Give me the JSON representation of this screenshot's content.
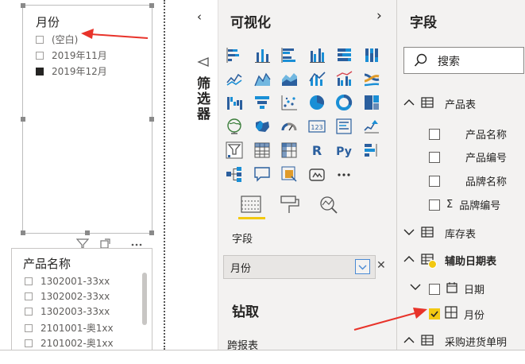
{
  "slicer_month": {
    "title": "月份",
    "items": [
      {
        "label": "(空白)",
        "checked": false
      },
      {
        "label": "2019年11月",
        "checked": false
      },
      {
        "label": "2019年12月",
        "checked": true
      }
    ]
  },
  "slicer_product": {
    "title": "产品名称",
    "items": [
      "1302001-33xx",
      "1302002-33xx",
      "1302003-33xx",
      "2101001-奥1xx",
      "2101002-奥1xx"
    ]
  },
  "filters_label": "筛选器",
  "visualizations": {
    "title": "可视化",
    "icons": [
      "stacked-bar-icon",
      "stacked-column-icon",
      "clustered-bar-icon",
      "clustered-column-icon",
      "100-stacked-bar-icon",
      "100-stacked-column-icon",
      "line-chart-icon",
      "area-chart-icon",
      "stacked-area-icon",
      "line-column-icon",
      "line-clustered-column-icon",
      "ribbon-chart-icon",
      "waterfall-icon",
      "funnel-icon",
      "scatter-icon",
      "pie-chart-icon",
      "donut-chart-icon",
      "treemap-icon",
      "map-icon",
      "filled-map-icon",
      "gauge-icon",
      "card-icon",
      "multirow-card-icon",
      "kpi-icon",
      "slicer-icon",
      "table-icon",
      "matrix-icon",
      "r-visual-icon",
      "python-visual-icon",
      "key-influencers-icon",
      "decomposition-tree-icon",
      "qa-icon",
      "smart-narrative-icon",
      "paginated-report-icon",
      "more-icon"
    ],
    "r_label": "R",
    "py_label": "Py",
    "card_label": "123",
    "more_label": "···",
    "field_section": "字段",
    "field_value": "月份",
    "drill_title": "钻取",
    "cross_report": "跨报表"
  },
  "fields": {
    "title": "字段",
    "search_placeholder": "搜索",
    "tables": [
      {
        "name": "产品表",
        "expanded": true,
        "fields": [
          {
            "name": "产品名称",
            "checked": false,
            "sigma": false
          },
          {
            "name": "产品编号",
            "checked": false,
            "sigma": false
          },
          {
            "name": "品牌名称",
            "checked": false,
            "sigma": false
          },
          {
            "name": "品牌编号",
            "checked": false,
            "sigma": true
          }
        ]
      },
      {
        "name": "库存表",
        "expanded": false,
        "fields": []
      },
      {
        "name": "辅助日期表",
        "expanded": true,
        "bold": true,
        "fields": [
          {
            "name": "日期",
            "checked": false,
            "type": "calendar"
          },
          {
            "name": "月份",
            "checked": true,
            "type": "hierarchy"
          }
        ]
      },
      {
        "name": "采购进货单明",
        "expanded": true,
        "fields": []
      }
    ]
  },
  "colors": {
    "accent_yellow": "#f2c811",
    "arrow_red": "#e8332a"
  }
}
